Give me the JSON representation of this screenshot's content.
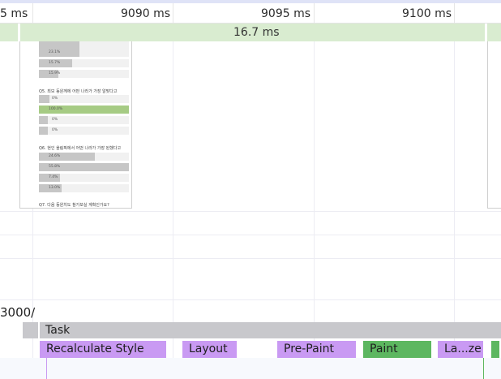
{
  "ruler": {
    "ticks": [
      "5 ms",
      "9090 ms",
      "9095 ms",
      "9100 ms"
    ]
  },
  "frames": {
    "duration_label": "16.7 ms"
  },
  "screenshot": {
    "questions": [
      {
        "title": "",
        "bars": [
          {
            "label": "",
            "value": 0.0
          },
          {
            "label": "23.1%",
            "value": 23.1
          },
          {
            "label": "15.7%",
            "value": 15.7
          },
          {
            "label": "15.9%",
            "value": 15.9
          }
        ]
      },
      {
        "title": "Q5. 최모 동원께에 어떤 나라가 가장 알맞다고",
        "bars": [
          {
            "label": "0%",
            "value": 0
          },
          {
            "label": "100.0%",
            "value": 100,
            "highlight": true
          },
          {
            "label": "0%",
            "value": 0
          },
          {
            "label": "0%",
            "value": 0
          }
        ]
      },
      {
        "title": "Q6. 현인 올림픽에서 어떤 나라가 가장 된했다고",
        "bars": [
          {
            "label": "24.6%",
            "value": 24.6
          },
          {
            "label": "55.8%",
            "value": 55.8
          },
          {
            "label": "7.4%",
            "value": 7.4
          },
          {
            "label": "13.0%",
            "value": 13.0
          }
        ]
      },
      {
        "title": "Q7. 다음 동원치도 참가보실 계획인가요?",
        "bars": []
      }
    ]
  },
  "track": {
    "name": "3000/"
  },
  "task": {
    "label": "Task"
  },
  "events": [
    {
      "label": "Recalculate Style",
      "color": "#c99af3"
    },
    {
      "label": "Layout",
      "color": "#c99af3"
    },
    {
      "label": "Pre-Paint",
      "color": "#c99af3"
    },
    {
      "label": "Paint",
      "color": "#5db760"
    },
    {
      "label": "La...ze",
      "color": "#c99af3"
    },
    {
      "label": "",
      "color": "#5db760"
    }
  ]
}
